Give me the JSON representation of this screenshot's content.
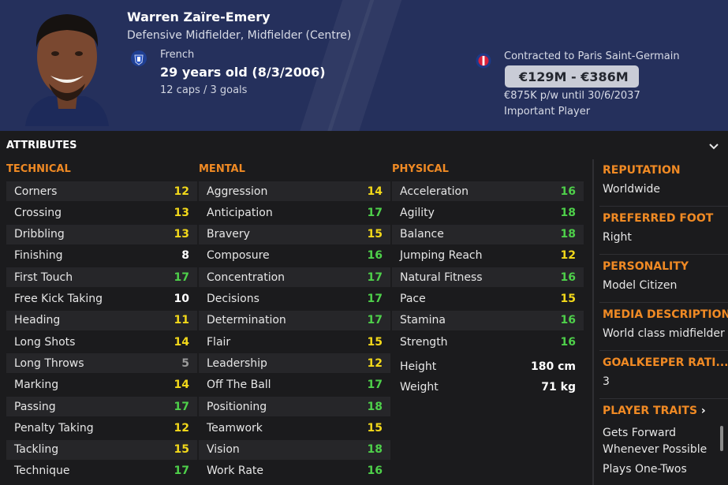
{
  "player": {
    "name": "Warren Zaïre-Emery",
    "position": "Defensive Midfielder, Midfielder (Centre)",
    "nationality": "French",
    "age": "29 years old (8/3/2006)",
    "caps": "12 caps / 3 goals",
    "contract": "Contracted to Paris Saint-Germain",
    "value": "€129M - €386M",
    "wage": "€875K p/w until 30/6/2037",
    "squad_status": "Important Player"
  },
  "icons": {
    "nation": "france-federation-badge-icon",
    "club": "psg-club-badge-icon",
    "collapse": "chevron-down-icon"
  },
  "colors": {
    "header_bg": "#25305c",
    "section_heading": "#f08a24",
    "attr_green": "#4ed04a",
    "attr_yellow": "#f2d81a",
    "attr_white": "#ffffff",
    "attr_grey": "#9a9a9a"
  },
  "attributes": {
    "title": "ATTRIBUTES",
    "technical": {
      "heading": "TECHNICAL",
      "items": [
        {
          "label": "Corners",
          "value": "12"
        },
        {
          "label": "Crossing",
          "value": "13"
        },
        {
          "label": "Dribbling",
          "value": "13"
        },
        {
          "label": "Finishing",
          "value": "8"
        },
        {
          "label": "First Touch",
          "value": "17"
        },
        {
          "label": "Free Kick Taking",
          "value": "10"
        },
        {
          "label": "Heading",
          "value": "11"
        },
        {
          "label": "Long Shots",
          "value": "14"
        },
        {
          "label": "Long Throws",
          "value": "5"
        },
        {
          "label": "Marking",
          "value": "14"
        },
        {
          "label": "Passing",
          "value": "17"
        },
        {
          "label": "Penalty Taking",
          "value": "12"
        },
        {
          "label": "Tackling",
          "value": "15"
        },
        {
          "label": "Technique",
          "value": "17"
        }
      ]
    },
    "mental": {
      "heading": "MENTAL",
      "items": [
        {
          "label": "Aggression",
          "value": "14"
        },
        {
          "label": "Anticipation",
          "value": "17"
        },
        {
          "label": "Bravery",
          "value": "15"
        },
        {
          "label": "Composure",
          "value": "16"
        },
        {
          "label": "Concentration",
          "value": "17"
        },
        {
          "label": "Decisions",
          "value": "17"
        },
        {
          "label": "Determination",
          "value": "17"
        },
        {
          "label": "Flair",
          "value": "15"
        },
        {
          "label": "Leadership",
          "value": "12"
        },
        {
          "label": "Off The Ball",
          "value": "17"
        },
        {
          "label": "Positioning",
          "value": "18"
        },
        {
          "label": "Teamwork",
          "value": "15"
        },
        {
          "label": "Vision",
          "value": "18"
        },
        {
          "label": "Work Rate",
          "value": "16"
        }
      ]
    },
    "physical": {
      "heading": "PHYSICAL",
      "items": [
        {
          "label": "Acceleration",
          "value": "16"
        },
        {
          "label": "Agility",
          "value": "18"
        },
        {
          "label": "Balance",
          "value": "18"
        },
        {
          "label": "Jumping Reach",
          "value": "12"
        },
        {
          "label": "Natural Fitness",
          "value": "16"
        },
        {
          "label": "Pace",
          "value": "15"
        },
        {
          "label": "Stamina",
          "value": "16"
        },
        {
          "label": "Strength",
          "value": "16"
        }
      ],
      "height_label": "Height",
      "height_value": "180 cm",
      "weight_label": "Weight",
      "weight_value": "71 kg"
    }
  },
  "info": {
    "reputation_heading": "REPUTATION",
    "reputation": "Worldwide",
    "foot_heading": "PREFERRED FOOT",
    "foot": "Right",
    "personality_heading": "PERSONALITY",
    "personality": "Model Citizen",
    "media_heading": "MEDIA DESCRIPTION",
    "media": "World class midfielder",
    "gk_heading": "GOALKEEPER RATI...",
    "gk": "3",
    "traits_heading": "PLAYER TRAITS",
    "traits_arrow": "›",
    "traits": [
      "Gets Forward",
      "Whenever Possible",
      "Plays One-Twos"
    ]
  }
}
